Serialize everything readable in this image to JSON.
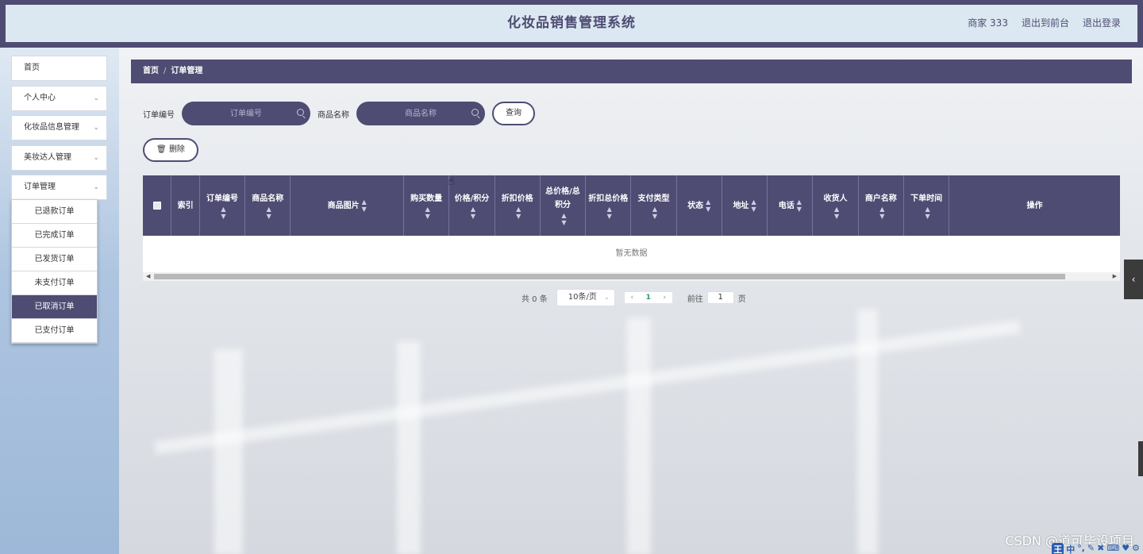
{
  "header": {
    "app_title": "化妆品销售管理系统",
    "user_label": "商家 333",
    "back_to_front": "退出到前台",
    "logout": "退出登录"
  },
  "sidebar": {
    "items": [
      {
        "label": "首页",
        "has_children": false
      },
      {
        "label": "个人中心",
        "has_children": true
      },
      {
        "label": "化妆品信息管理",
        "has_children": true
      },
      {
        "label": "美妆达人管理",
        "has_children": true
      },
      {
        "label": "订单管理",
        "has_children": true
      }
    ],
    "order_submenu": [
      {
        "label": "已退款订单",
        "active": false
      },
      {
        "label": "已完成订单",
        "active": false
      },
      {
        "label": "已发货订单",
        "active": false
      },
      {
        "label": "未支付订单",
        "active": false
      },
      {
        "label": "已取消订单",
        "active": true
      },
      {
        "label": "已支付订单",
        "active": false
      }
    ]
  },
  "breadcrumb": {
    "home": "首页",
    "separator": "/",
    "current": "订单管理"
  },
  "search": {
    "order_no_label": "订单编号",
    "order_no_placeholder": "订单编号",
    "product_name_label": "商品名称",
    "product_name_placeholder": "商品名称",
    "query_button": "查询"
  },
  "actions": {
    "delete_button": "删除"
  },
  "table": {
    "columns": [
      "索引",
      "订单编号",
      "商品名称",
      "商品图片",
      "购买数量",
      "价格/积分",
      "折扣价格",
      "总价格/总积分",
      "折扣总价格",
      "支付类型",
      "状态",
      "地址",
      "电话",
      "收货人",
      "商户名称",
      "下单时间",
      "操作"
    ],
    "empty_text": "暂无数据"
  },
  "pagination": {
    "total_text": "共 0 条",
    "page_size": "10条/页",
    "current_page": "1",
    "goto_label": "前往",
    "goto_value": "1",
    "page_suffix": "页"
  },
  "overlay": {
    "watermark": "CSDN @道可毕设项目",
    "ime_logo": "王",
    "ime_text": "中"
  },
  "colors": {
    "primary": "#4e4c72",
    "header_bg": "#dbe8f1",
    "current_page": "#2c9b6b"
  }
}
